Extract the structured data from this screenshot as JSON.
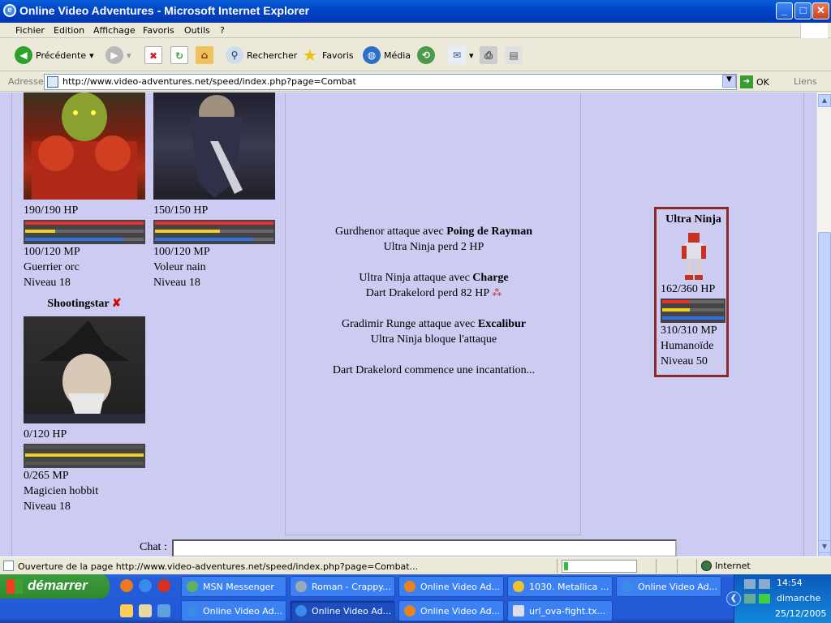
{
  "window": {
    "title": "Online Video Adventures - Microsoft Internet Explorer",
    "min": "_",
    "max": "□",
    "close": "✕"
  },
  "menu": [
    "Fichier",
    "Edition",
    "Affichage",
    "Favoris",
    "Outils",
    "?"
  ],
  "toolbar": {
    "back": "Précédente",
    "search": "Rechercher",
    "favorites": "Favoris",
    "media": "Média"
  },
  "address": {
    "label": "Adresse",
    "url": "http://www.video-adventures.net/speed/index.php?page=Combat",
    "go": "OK",
    "links": "Liens"
  },
  "party": [
    {
      "hp": "190/190 HP",
      "mp": "100/120 MP",
      "class": "Guerrier orc",
      "level": "Niveau 18",
      "hp_frac": 1.0,
      "mp_frac": 0.83,
      "portrait": "orc-warrior"
    },
    {
      "hp": "150/150 HP",
      "mp": "100/120 MP",
      "class": "Voleur nain",
      "level": "Niveau 18",
      "hp_frac": 1.0,
      "mp_frac": 0.83,
      "portrait": "dwarf-thief"
    },
    {
      "name": "Shootingstar",
      "status_mark": "✘",
      "hp": "0/120 HP",
      "mp": "0/265 MP",
      "class": "Magicien hobbit",
      "level": "Niveau 18",
      "hp_frac": 0.0,
      "mp_frac": 0.0,
      "portrait": "hobbit-wizard"
    }
  ],
  "combat_log": [
    {
      "line1_prefix": "Gurdhenor attaque avec ",
      "line1_bold": "Poing de Rayman",
      "line2": "Ultra Ninja perd 2 HP"
    },
    {
      "line1_prefix": "Ultra Ninja attaque avec ",
      "line1_bold": "Charge",
      "line2": "Dart Drakelord perd 82 HP"
    },
    {
      "line1_prefix": "Gradimir Runge attaque avec ",
      "line1_bold": "Excalibur",
      "line2": "Ultra Ninja bloque l'attaque"
    },
    {
      "line1_prefix": "Dart Drakelord commence une incantation...",
      "line1_bold": "",
      "line2": ""
    }
  ],
  "enemy": {
    "name": "Ultra Ninja",
    "hp": "162/360 HP",
    "mp": "310/310 MP",
    "type": "Humanoïde",
    "level": "Niveau 50",
    "hp_frac": 0.45,
    "mp_frac": 1.0
  },
  "chat": {
    "label": "Chat :"
  },
  "status": {
    "message": "Ouverture de la page http://www.video-adventures.net/speed/index.php?page=Combat...",
    "zone": "Internet",
    "progress": 0.05
  },
  "taskbar": {
    "start": "démarrer",
    "row1": [
      "MSN Messenger",
      "Roman - Crappy...",
      "Online Video Ad...",
      "1030. Metallica ...",
      "Online Video Ad..."
    ],
    "row2": [
      "Online Video Ad...",
      "Online Video Ad...",
      "Online Video Ad...",
      "url_ova-fight.tx..."
    ],
    "time": "14:54",
    "day": "dimanche",
    "date": "25/12/2005"
  },
  "colors": {
    "hp_bar": "#e83030",
    "hp_bar_low": "#f0d020",
    "mp_bar": "#3070e0",
    "enemy_border": "#8b2a2a",
    "content_bg": "#ccccf2"
  }
}
